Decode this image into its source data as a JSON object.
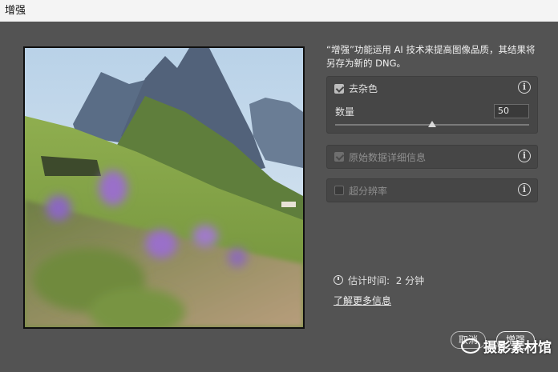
{
  "window": {
    "title": "增强"
  },
  "description": "“增强”功能运用 AI 技术来提高图像品质，其结果将另存为新的 DNG。",
  "options": {
    "denoise": {
      "label": "去杂色",
      "checked": true,
      "amount_label": "数量",
      "amount_value": "50",
      "slider_fraction": 0.5
    },
    "raw_details": {
      "label": "原始数据详细信息",
      "checked": true,
      "disabled": true
    },
    "super_resolution": {
      "label": "超分辨率",
      "checked": false,
      "disabled": true
    }
  },
  "estimate": {
    "label": "估计时间:",
    "value": "2 分钟"
  },
  "learn_more": "了解更多信息",
  "buttons": {
    "cancel": "取消",
    "enhance": "增强"
  },
  "watermark": "摄影素材馆",
  "icons": [
    "checkbox-icon",
    "info-icon",
    "clock-icon",
    "wechat-icon"
  ]
}
